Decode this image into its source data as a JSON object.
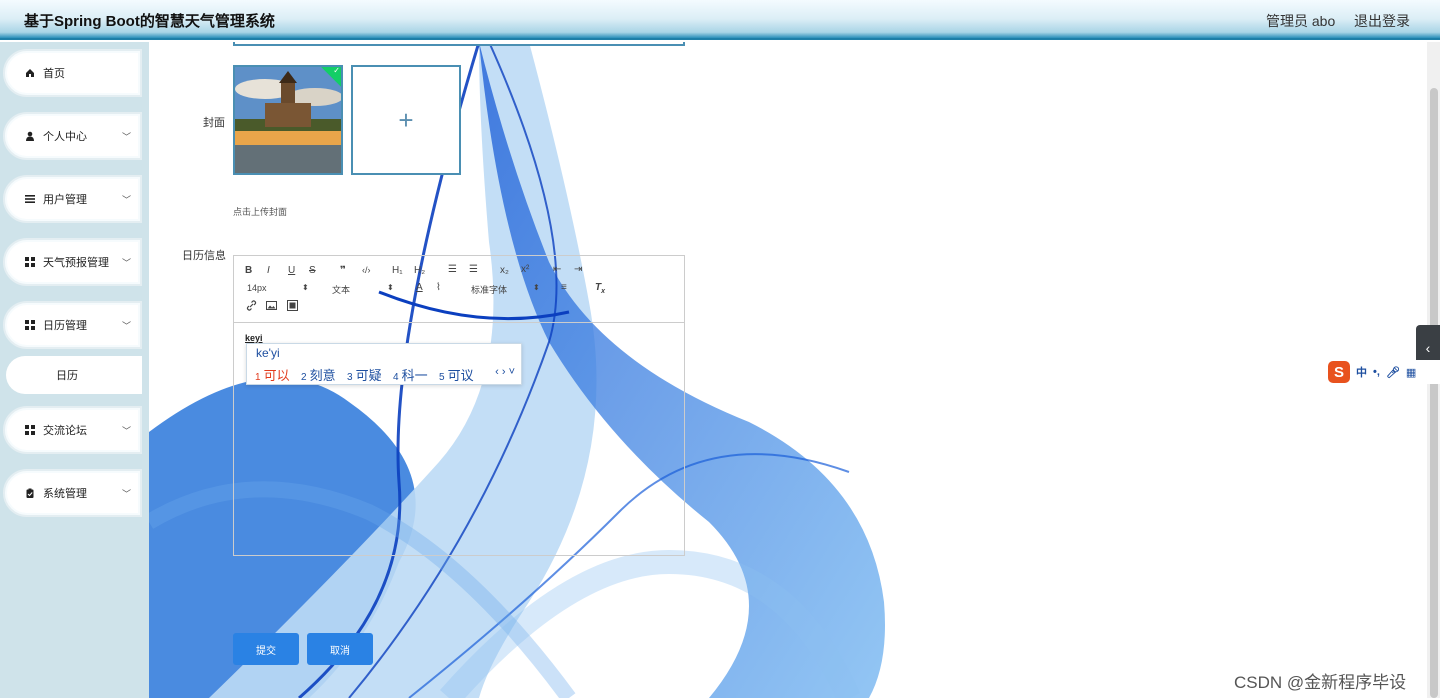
{
  "header": {
    "title": "基于Spring Boot的智慧天气管理系统",
    "user": "管理员 abo",
    "logout": "退出登录"
  },
  "sidebar": {
    "items": [
      {
        "label": "首页"
      },
      {
        "label": "个人中心"
      },
      {
        "label": "用户管理"
      },
      {
        "label": "天气预报管理"
      },
      {
        "label": "日历管理"
      },
      {
        "label": "交流论坛"
      },
      {
        "label": "系统管理"
      }
    ],
    "sub_item": "日历"
  },
  "form": {
    "cover_label": "封面",
    "upload_hint": "点击上传封面",
    "upload_plus": "+",
    "calendar_label": "日历信息",
    "submit": "提交",
    "cancel": "取消"
  },
  "editor": {
    "toolbar_row1": [
      "B",
      "I",
      "U",
      "S",
      "❞",
      "‹/›",
      "H₁",
      "H₂",
      "☰",
      "☰",
      "x₂",
      "x²",
      "⇤",
      "⇥"
    ],
    "font_size": "14px",
    "text_style": "文本",
    "font_family": "标准字体",
    "content": "keyi"
  },
  "ime": {
    "pinyin": "ke'yi",
    "candidates": [
      {
        "num": "1",
        "text": "可以"
      },
      {
        "num": "2",
        "text": "刻意"
      },
      {
        "num": "3",
        "text": "可疑"
      },
      {
        "num": "4",
        "text": "科一"
      },
      {
        "num": "5",
        "text": "可议"
      }
    ],
    "bar_label": "中"
  },
  "watermark": "CSDN @金新程序毕设"
}
